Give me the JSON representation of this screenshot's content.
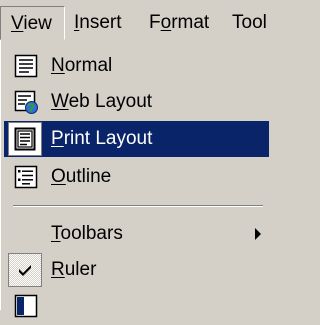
{
  "menubar": {
    "items": [
      {
        "label": "View",
        "mnemonic": "V",
        "rest": "iew"
      },
      {
        "label": "Insert",
        "mnemonic": "I",
        "rest": "nsert"
      },
      {
        "label": "Format",
        "pre": "F",
        "mnemonic": "o",
        "rest": "rmat"
      },
      {
        "label": "Tools",
        "pre": "Tool",
        "mnemonic": "",
        "rest": ""
      }
    ]
  },
  "view_menu": {
    "items": [
      {
        "mnemonic": "N",
        "rest": "ormal",
        "icon": "normal-view-icon"
      },
      {
        "mnemonic": "W",
        "rest": "eb Layout",
        "icon": "web-layout-icon"
      },
      {
        "mnemonic": "P",
        "rest": "rint Layout",
        "icon": "print-layout-icon",
        "highlighted": true
      },
      {
        "mnemonic": "O",
        "rest": "utline",
        "icon": "outline-view-icon"
      },
      {
        "pre": "",
        "mnemonic": "T",
        "rest": "oolbars",
        "submenu": true
      },
      {
        "mnemonic": "R",
        "rest": "uler",
        "checked": true
      }
    ]
  },
  "colors": {
    "menu_bg": "#d4d0c8",
    "highlight_bg": "#0a246a",
    "highlight_text": "#ffffff"
  }
}
